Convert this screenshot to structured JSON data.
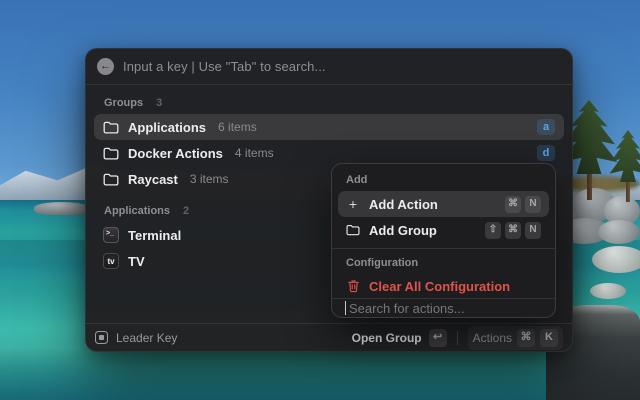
{
  "window": {
    "header": {
      "input_text": "Input a key | Use \"Tab\" to search...",
      "back_glyph": "←"
    },
    "groups_section": {
      "label": "Groups",
      "count": "3"
    },
    "group_rows": [
      {
        "label": "Applications",
        "meta": "6 items",
        "badge": "a"
      },
      {
        "label": "Docker Actions",
        "meta": "4 items",
        "badge": "d"
      },
      {
        "label": "Raycast",
        "meta": "3 items",
        "badge": ""
      }
    ],
    "apps_section": {
      "label": "Applications",
      "count": "2"
    },
    "app_rows": [
      {
        "label": "Terminal",
        "icon_glyph": ">_"
      },
      {
        "label": "TV",
        "icon_glyph": "tv"
      }
    ],
    "footer": {
      "app_name": "Leader Key",
      "primary_action": "Open Group",
      "primary_key": "↩",
      "secondary_action": "Actions",
      "secondary_keys": [
        "⌘",
        "K"
      ]
    }
  },
  "popup": {
    "add_label": "Add",
    "items": [
      {
        "label": "Add Action",
        "keys": [
          "⌘",
          "N"
        ]
      },
      {
        "label": "Add Group",
        "keys": [
          "⇧",
          "⌘",
          "N"
        ]
      }
    ],
    "config_label": "Configuration",
    "danger_item": {
      "label": "Clear All Configuration"
    },
    "search_placeholder": "Search for actions..."
  },
  "colors": {
    "accent_blue": "#5da4e4",
    "danger_red": "#e0524b",
    "selection": "#3a3a3d"
  }
}
